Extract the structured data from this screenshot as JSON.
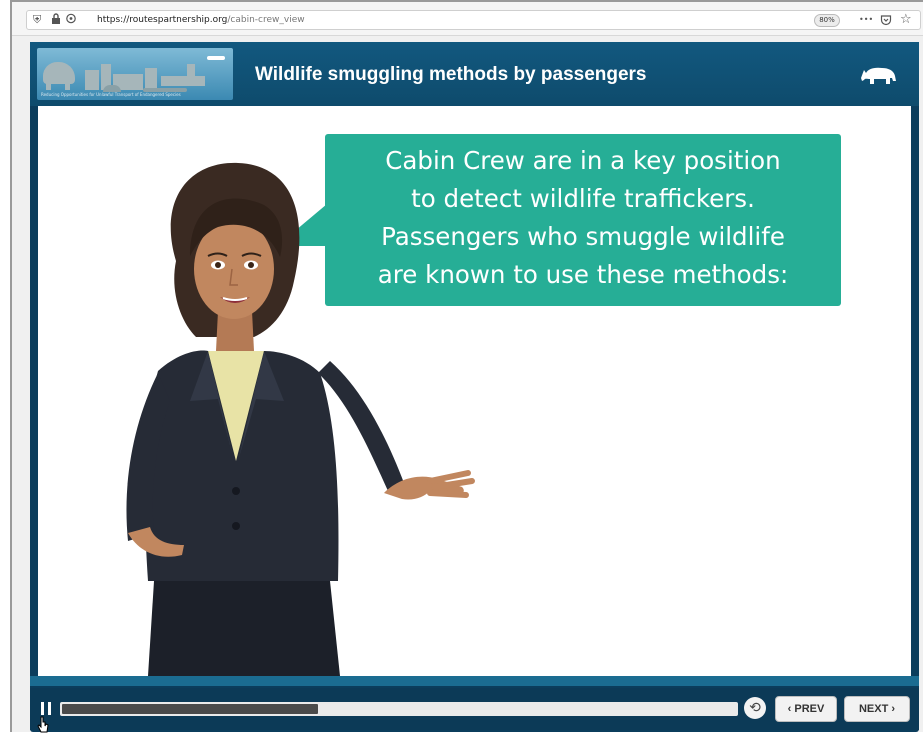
{
  "browser": {
    "url_host": "https://routespartnership.org",
    "url_path": "/cabin-crew_view",
    "zoom": "80%",
    "menu_glyph": "•••",
    "icons": [
      "shield-icon",
      "lock-icon",
      "permissions-icon",
      "pocket-icon",
      "bookmark-star-icon"
    ]
  },
  "header": {
    "title": "Wildlife smuggling methods by passengers",
    "banner_caption": "Reducing Opportunities for Unlawful Transport of Endangered Species",
    "logo_icon": "rhino-icon"
  },
  "slide": {
    "speech_lines": [
      "Cabin Crew are in a key position",
      "to detect wildlife traffickers.",
      "Passengers who smuggle wildlife",
      "are known to use these methods:"
    ]
  },
  "player": {
    "progress": 0.38,
    "replay_glyph": "⟲",
    "prev_label": "‹  PREV",
    "next_label": "NEXT  ›"
  },
  "colors": {
    "header": "#0e4b6c",
    "bubble": "#26ae96",
    "controls": "#0c3a57"
  }
}
